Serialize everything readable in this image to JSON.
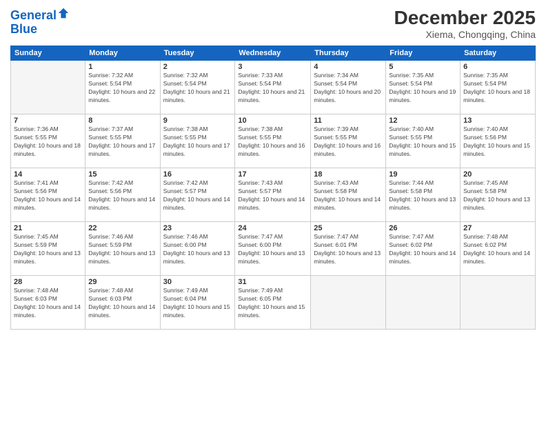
{
  "header": {
    "logo_line1": "General",
    "logo_line2": "Blue",
    "month_title": "December 2025",
    "location": "Xiema, Chongqing, China"
  },
  "weekdays": [
    "Sunday",
    "Monday",
    "Tuesday",
    "Wednesday",
    "Thursday",
    "Friday",
    "Saturday"
  ],
  "weeks": [
    [
      {
        "day": "",
        "sunrise": "",
        "sunset": "",
        "daylight": ""
      },
      {
        "day": "1",
        "sunrise": "Sunrise: 7:32 AM",
        "sunset": "Sunset: 5:54 PM",
        "daylight": "Daylight: 10 hours and 22 minutes."
      },
      {
        "day": "2",
        "sunrise": "Sunrise: 7:32 AM",
        "sunset": "Sunset: 5:54 PM",
        "daylight": "Daylight: 10 hours and 21 minutes."
      },
      {
        "day": "3",
        "sunrise": "Sunrise: 7:33 AM",
        "sunset": "Sunset: 5:54 PM",
        "daylight": "Daylight: 10 hours and 21 minutes."
      },
      {
        "day": "4",
        "sunrise": "Sunrise: 7:34 AM",
        "sunset": "Sunset: 5:54 PM",
        "daylight": "Daylight: 10 hours and 20 minutes."
      },
      {
        "day": "5",
        "sunrise": "Sunrise: 7:35 AM",
        "sunset": "Sunset: 5:54 PM",
        "daylight": "Daylight: 10 hours and 19 minutes."
      },
      {
        "day": "6",
        "sunrise": "Sunrise: 7:35 AM",
        "sunset": "Sunset: 5:54 PM",
        "daylight": "Daylight: 10 hours and 18 minutes."
      }
    ],
    [
      {
        "day": "7",
        "sunrise": "Sunrise: 7:36 AM",
        "sunset": "Sunset: 5:55 PM",
        "daylight": "Daylight: 10 hours and 18 minutes."
      },
      {
        "day": "8",
        "sunrise": "Sunrise: 7:37 AM",
        "sunset": "Sunset: 5:55 PM",
        "daylight": "Daylight: 10 hours and 17 minutes."
      },
      {
        "day": "9",
        "sunrise": "Sunrise: 7:38 AM",
        "sunset": "Sunset: 5:55 PM",
        "daylight": "Daylight: 10 hours and 17 minutes."
      },
      {
        "day": "10",
        "sunrise": "Sunrise: 7:38 AM",
        "sunset": "Sunset: 5:55 PM",
        "daylight": "Daylight: 10 hours and 16 minutes."
      },
      {
        "day": "11",
        "sunrise": "Sunrise: 7:39 AM",
        "sunset": "Sunset: 5:55 PM",
        "daylight": "Daylight: 10 hours and 16 minutes."
      },
      {
        "day": "12",
        "sunrise": "Sunrise: 7:40 AM",
        "sunset": "Sunset: 5:55 PM",
        "daylight": "Daylight: 10 hours and 15 minutes."
      },
      {
        "day": "13",
        "sunrise": "Sunrise: 7:40 AM",
        "sunset": "Sunset: 5:56 PM",
        "daylight": "Daylight: 10 hours and 15 minutes."
      }
    ],
    [
      {
        "day": "14",
        "sunrise": "Sunrise: 7:41 AM",
        "sunset": "Sunset: 5:56 PM",
        "daylight": "Daylight: 10 hours and 14 minutes."
      },
      {
        "day": "15",
        "sunrise": "Sunrise: 7:42 AM",
        "sunset": "Sunset: 5:56 PM",
        "daylight": "Daylight: 10 hours and 14 minutes."
      },
      {
        "day": "16",
        "sunrise": "Sunrise: 7:42 AM",
        "sunset": "Sunset: 5:57 PM",
        "daylight": "Daylight: 10 hours and 14 minutes."
      },
      {
        "day": "17",
        "sunrise": "Sunrise: 7:43 AM",
        "sunset": "Sunset: 5:57 PM",
        "daylight": "Daylight: 10 hours and 14 minutes."
      },
      {
        "day": "18",
        "sunrise": "Sunrise: 7:43 AM",
        "sunset": "Sunset: 5:58 PM",
        "daylight": "Daylight: 10 hours and 14 minutes."
      },
      {
        "day": "19",
        "sunrise": "Sunrise: 7:44 AM",
        "sunset": "Sunset: 5:58 PM",
        "daylight": "Daylight: 10 hours and 13 minutes."
      },
      {
        "day": "20",
        "sunrise": "Sunrise: 7:45 AM",
        "sunset": "Sunset: 5:58 PM",
        "daylight": "Daylight: 10 hours and 13 minutes."
      }
    ],
    [
      {
        "day": "21",
        "sunrise": "Sunrise: 7:45 AM",
        "sunset": "Sunset: 5:59 PM",
        "daylight": "Daylight: 10 hours and 13 minutes."
      },
      {
        "day": "22",
        "sunrise": "Sunrise: 7:46 AM",
        "sunset": "Sunset: 5:59 PM",
        "daylight": "Daylight: 10 hours and 13 minutes."
      },
      {
        "day": "23",
        "sunrise": "Sunrise: 7:46 AM",
        "sunset": "Sunset: 6:00 PM",
        "daylight": "Daylight: 10 hours and 13 minutes."
      },
      {
        "day": "24",
        "sunrise": "Sunrise: 7:47 AM",
        "sunset": "Sunset: 6:00 PM",
        "daylight": "Daylight: 10 hours and 13 minutes."
      },
      {
        "day": "25",
        "sunrise": "Sunrise: 7:47 AM",
        "sunset": "Sunset: 6:01 PM",
        "daylight": "Daylight: 10 hours and 13 minutes."
      },
      {
        "day": "26",
        "sunrise": "Sunrise: 7:47 AM",
        "sunset": "Sunset: 6:02 PM",
        "daylight": "Daylight: 10 hours and 14 minutes."
      },
      {
        "day": "27",
        "sunrise": "Sunrise: 7:48 AM",
        "sunset": "Sunset: 6:02 PM",
        "daylight": "Daylight: 10 hours and 14 minutes."
      }
    ],
    [
      {
        "day": "28",
        "sunrise": "Sunrise: 7:48 AM",
        "sunset": "Sunset: 6:03 PM",
        "daylight": "Daylight: 10 hours and 14 minutes."
      },
      {
        "day": "29",
        "sunrise": "Sunrise: 7:48 AM",
        "sunset": "Sunset: 6:03 PM",
        "daylight": "Daylight: 10 hours and 14 minutes."
      },
      {
        "day": "30",
        "sunrise": "Sunrise: 7:49 AM",
        "sunset": "Sunset: 6:04 PM",
        "daylight": "Daylight: 10 hours and 15 minutes."
      },
      {
        "day": "31",
        "sunrise": "Sunrise: 7:49 AM",
        "sunset": "Sunset: 6:05 PM",
        "daylight": "Daylight: 10 hours and 15 minutes."
      },
      {
        "day": "",
        "sunrise": "",
        "sunset": "",
        "daylight": ""
      },
      {
        "day": "",
        "sunrise": "",
        "sunset": "",
        "daylight": ""
      },
      {
        "day": "",
        "sunrise": "",
        "sunset": "",
        "daylight": ""
      }
    ]
  ]
}
